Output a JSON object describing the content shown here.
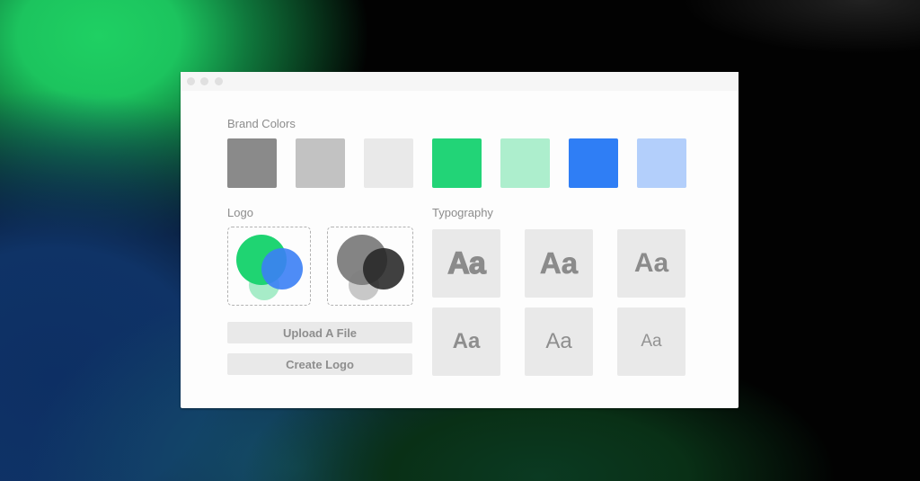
{
  "window": {
    "controls": [
      "close",
      "minimize",
      "maximize"
    ]
  },
  "brand_colors": {
    "label": "Brand Colors",
    "swatches": [
      {
        "name": "dark-gray",
        "color": "#8a8a8a"
      },
      {
        "name": "medium-gray",
        "color": "#c2c2c2"
      },
      {
        "name": "light-gray",
        "color": "#e9e9e9"
      },
      {
        "name": "green",
        "color": "#22d477"
      },
      {
        "name": "light-green",
        "color": "#adeecd"
      },
      {
        "name": "blue",
        "color": "#2f7ef5"
      },
      {
        "name": "light-blue",
        "color": "#b3cffb"
      }
    ]
  },
  "logo": {
    "label": "Logo",
    "color_variant": {
      "circle_large": "#1fd472",
      "circle_overlap": "#3b7ff5",
      "circle_small": "#a7ecc8"
    },
    "mono_variant": {
      "circle_large": "#7d7d7d",
      "circle_overlap": "#262626",
      "circle_small": "#c8c8c8"
    },
    "upload_button": "Upload A File",
    "create_button": "Create Logo"
  },
  "typography": {
    "label": "Typography",
    "samples": [
      {
        "text": "Aa",
        "weight": "heaviest"
      },
      {
        "text": "Aa",
        "weight": "bold"
      },
      {
        "text": "Aa",
        "weight": "semibold"
      },
      {
        "text": "Aa",
        "weight": "medium"
      },
      {
        "text": "Aa",
        "weight": "regular"
      },
      {
        "text": "Aa",
        "weight": "light"
      }
    ]
  }
}
